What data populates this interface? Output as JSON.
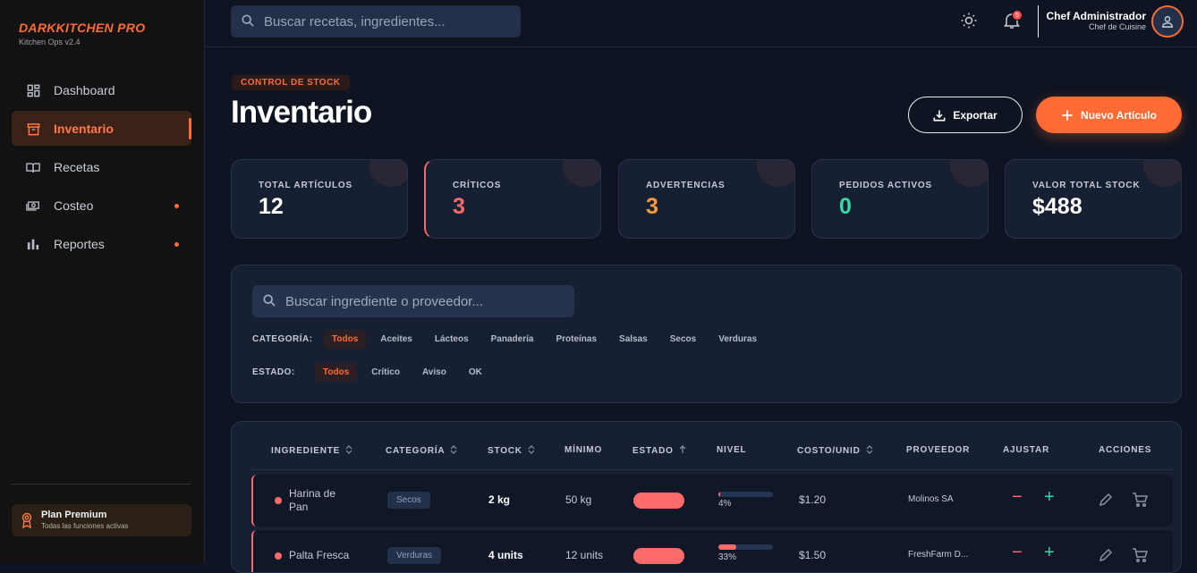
{
  "sidebar": {
    "brand": "DARKKITCHEN PRO",
    "brand_sub": "Kitchen Ops v2.4",
    "items": [
      {
        "label": "Dashboard",
        "icon": "dashboard-icon"
      },
      {
        "label": "Inventario",
        "icon": "inventory-icon",
        "active": true
      },
      {
        "label": "Recetas",
        "icon": "book-icon"
      },
      {
        "label": "Costeo",
        "icon": "money-icon",
        "dot": true
      },
      {
        "label": "Reportes",
        "icon": "bar-chart-icon",
        "dot": true
      }
    ],
    "plan_title": "Plan Premium",
    "plan_sub": "Todas las funciones activas"
  },
  "topbar": {
    "search_placeholder": "Buscar recetas, ingredientes...",
    "notifications": "5",
    "user_name": "Chef Administrador",
    "user_role": "Chef de Cuisine"
  },
  "header": {
    "eyebrow": "CONTROL DE STOCK",
    "title": "Inventario",
    "export_label": "Exportar",
    "new_label": "Nuevo Artículo"
  },
  "stats": [
    {
      "label": "TOTAL ARTÍCULOS",
      "value": "12",
      "color": "#ffffff"
    },
    {
      "label": "CRÍTICOS",
      "value": "3",
      "color": "#ff6b6b"
    },
    {
      "label": "ADVERTENCIAS",
      "value": "3",
      "color": "#ff9a3c"
    },
    {
      "label": "PEDIDOS ACTIVOS",
      "value": "0",
      "color": "#3ad6a3"
    },
    {
      "label": "VALOR TOTAL STOCK",
      "value": "$488",
      "color": "#ffffff"
    }
  ],
  "filters": {
    "search_placeholder": "Buscar ingrediente o proveedor...",
    "category_label": "CATEGORÍA:",
    "categories": [
      "Todos",
      "Aceites",
      "Lácteos",
      "Panadería",
      "Proteínas",
      "Salsas",
      "Secos",
      "Verduras"
    ],
    "status_label": "ESTADO:",
    "statuses": [
      "Todos",
      "Crítico",
      "Aviso",
      "OK"
    ]
  },
  "table": {
    "headers": [
      "INGREDIENTE",
      "CATEGORÍA",
      "STOCK",
      "MÍNIMO",
      "ESTADO",
      "NIVEL",
      "COSTO/UNID",
      "PROVEEDOR",
      "AJUSTAR",
      "ACCIONES"
    ],
    "rows": [
      {
        "name": "Harina de\nPan",
        "category": "Secos",
        "stock": "2 kg",
        "min": "50 kg",
        "level": 4,
        "level_label": "4%",
        "cost": "$1.20",
        "supplier": "Molinos SA"
      },
      {
        "name": "Palta Fresca",
        "category": "Verduras",
        "stock": "4 units",
        "min": "12 units",
        "level": 33,
        "level_label": "33%",
        "cost": "$1.50",
        "supplier": "FreshFarm D..."
      }
    ]
  },
  "colors": {
    "accent": "#ff6b35",
    "critical": "#ff6b6b",
    "ok": "#3ad6a3",
    "warning": "#ff9a3c"
  }
}
